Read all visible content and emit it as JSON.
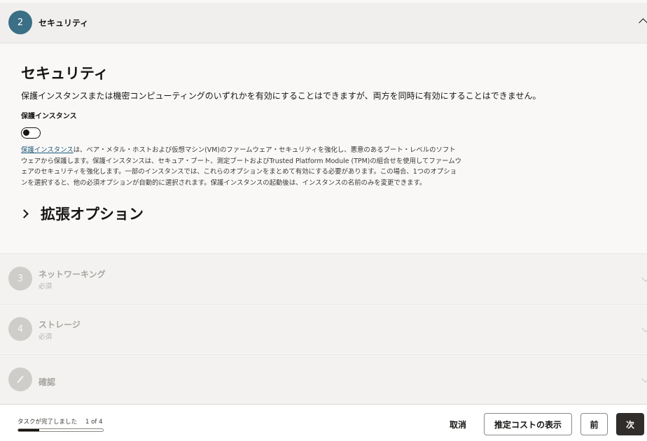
{
  "active_step": {
    "number": "2",
    "title": "セキュリティ"
  },
  "security": {
    "heading": "セキュリティ",
    "description": "保護インスタンスまたは機密コンピューティングのいずれかを有効にすることはできますが、両方を同時に有効にすることはできません。",
    "shielded_label": "保護インスタンス",
    "toggle_on": false,
    "help_link": "保護インスタンス",
    "help_line1": "は、ベア・メタル・ホストおよび仮想マシン(VM)のファームウェア・セキュリティを強化し、悪意のあるブート・レベルのソフト",
    "help_line2": "ウェアから保護します。保護インスタンスは、セキュア・ブート、測定ブートおよびTrusted Platform Module (TPM)の組合せを使用してファームウ",
    "help_line3": "ェアのセキュリティを強化します。一部のインスタンスでは、これらのオプションをまとめて有効にする必要があります。この場合、1つのオプショ",
    "help_line4": "ンを選択すると、他の必須オプションが自動的に選択されます。保護インスタンスの起動後は、インスタンスの名前のみを変更できます。",
    "advanced_title": "拡張オプション"
  },
  "steps": [
    {
      "number": "3",
      "name": "ネットワーキング",
      "sub": "必須"
    },
    {
      "number": "4",
      "name": "ストレージ",
      "sub": "必須"
    },
    {
      "name": "確認",
      "icon": "pencil-icon"
    }
  ],
  "footer": {
    "progress_text": "タスクが完了しました",
    "progress_count": "1 of 4",
    "progress_fraction": 0.25,
    "cancel": "取消",
    "cost": "推定コストの表示",
    "prev": "前",
    "next": "次"
  }
}
